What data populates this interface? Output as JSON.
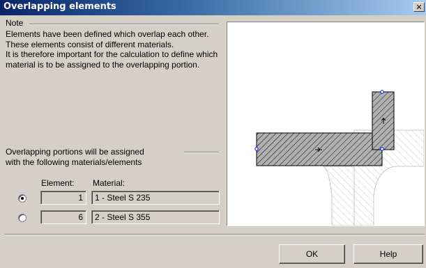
{
  "window": {
    "title": "Overlapping elements",
    "close_glyph": "✕"
  },
  "note": {
    "label": "Note",
    "paragraph1": "Elements have been defined which overlap each other. These elements consist of different materials.",
    "paragraph2": "It is therefore important for the calculation to define which material is to be assigned to the overlapping portion."
  },
  "assignment": {
    "label_line1": "Overlapping portions will be assigned",
    "label_line2": "with the following materials/elements",
    "element_header": "Element:",
    "material_header": "Material:",
    "rows": [
      {
        "element": "1",
        "material": "1 - Steel S 235",
        "selected": true
      },
      {
        "element": "6",
        "material": "2 - Steel S 355",
        "selected": false
      }
    ]
  },
  "preview": {
    "fill_color": "#b0b0b0",
    "hatch_color": "#000000",
    "ghost_color": "#c8c8c8",
    "node_color": "#0000ff",
    "icon": "cross-section-preview"
  },
  "buttons": {
    "ok": "OK",
    "help": "Help"
  }
}
